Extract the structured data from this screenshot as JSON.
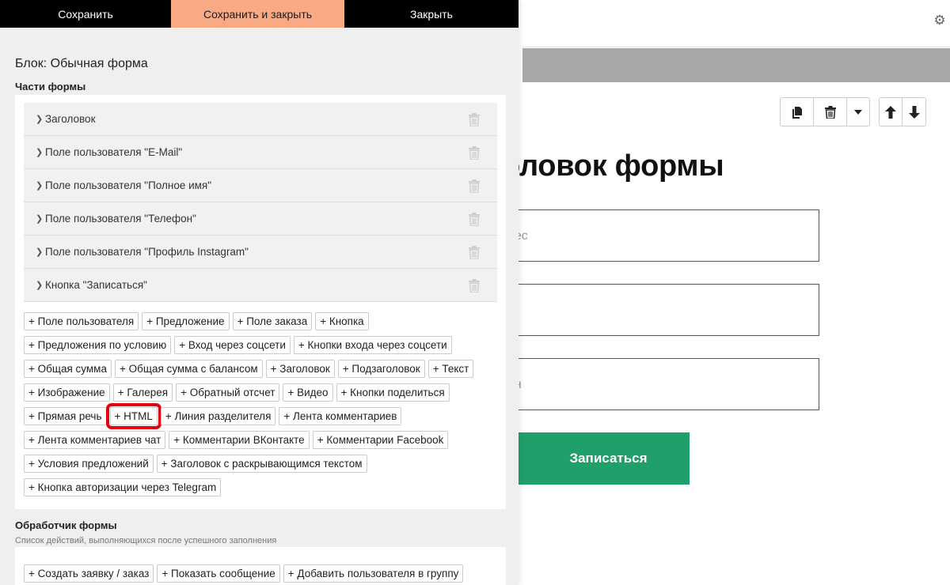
{
  "topbar": {
    "save": "Сохранить",
    "save_close": "Сохранить и закрыть",
    "close": "Закрыть",
    "save_close_color": "#f9a983"
  },
  "panel": {
    "block_title": "Блок: Обычная форма",
    "parts_title": "Части формы",
    "parts": [
      "Заголовок",
      "Поле пользователя \"E-Mail\"",
      "Поле пользователя \"Полное имя\"",
      "Поле пользователя \"Телефон\"",
      "Поле пользователя \"Профиль Instagram\"",
      "Кнопка \"Записаться\""
    ],
    "add_rows": [
      [
        "+ Поле пользователя",
        "+ Предложение",
        "+ Поле заказа",
        "+ Кнопка"
      ],
      [
        "+ Предложения по условию",
        "+ Вход через соцсети",
        "+ Кнопки входа через соцсети"
      ],
      [
        "+ Общая сумма",
        "+ Общая сумма с балансом",
        "+ Заголовок",
        "+ Подзаголовок",
        "+ Текст"
      ],
      [
        "+ Изображение",
        "+ Галерея",
        "+ Обратный отсчет",
        "+ Видео",
        "+ Кнопки поделиться"
      ],
      [
        "+ Прямая речь",
        "+ HTML",
        "+ Линия разделителя",
        "+ Лента комментариев"
      ],
      [
        "+ Лента комментариев чат",
        "+ Комментарии ВКонтакте",
        "+ Комментарии Facebook"
      ],
      [
        "+ Условия предложений",
        "+ Заголовок с раскрывающимся текстом"
      ],
      [
        "+ Кнопка авторизации через Telegram"
      ]
    ],
    "highlighted_chip": "+ HTML",
    "highlight_color": "#e00010",
    "handler_title": "Обработчик формы",
    "handler_subtitle": "Список действий, выполняющихся после успешного заполнения",
    "handler_actions": [
      "+ Создать заявку / заказ",
      "+ Показать сообщение",
      "+ Добавить пользователя в группу"
    ]
  },
  "preview": {
    "form_title": "оловок формы",
    "field1_placeholder": "рес",
    "field2_placeholder": "",
    "field3_placeholder": "он",
    "submit_label": "Записаться",
    "submit_color": "#1fa06b"
  }
}
